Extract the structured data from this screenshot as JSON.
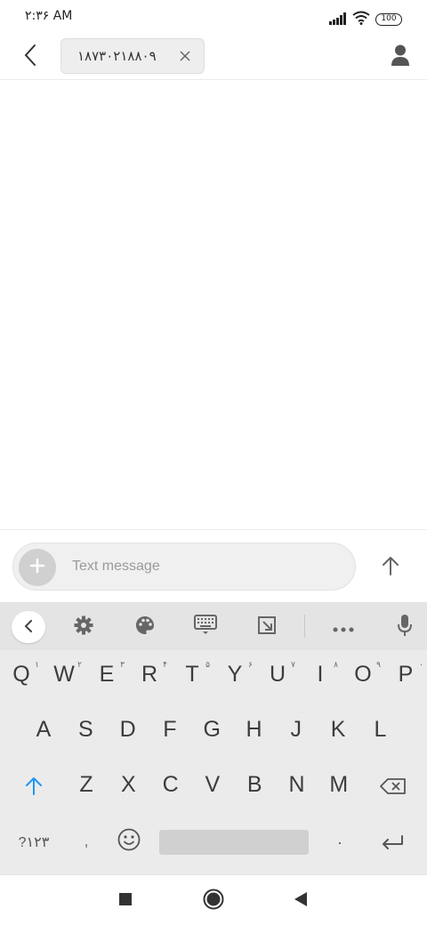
{
  "status_bar": {
    "time": "۲:۳۶ AM",
    "battery": "100"
  },
  "header": {
    "recipient": "۱۸۷۳۰۲۱۸۸۰۹"
  },
  "compose": {
    "placeholder": "Text message"
  },
  "keyboard": {
    "toolbar": [
      "collapse-icon",
      "gear-icon",
      "palette-icon",
      "keyboard-icon",
      "resize-icon",
      "more-icon",
      "mic-icon"
    ],
    "row1": [
      {
        "label": "Q",
        "hint": "۱"
      },
      {
        "label": "W",
        "hint": "۲"
      },
      {
        "label": "E",
        "hint": "۳"
      },
      {
        "label": "R",
        "hint": "۴"
      },
      {
        "label": "T",
        "hint": "۵"
      },
      {
        "label": "Y",
        "hint": "۶"
      },
      {
        "label": "U",
        "hint": "۷"
      },
      {
        "label": "I",
        "hint": "۸"
      },
      {
        "label": "O",
        "hint": "۹"
      },
      {
        "label": "P",
        "hint": "۰"
      }
    ],
    "row2": [
      "A",
      "S",
      "D",
      "F",
      "G",
      "H",
      "J",
      "K",
      "L"
    ],
    "row3": [
      "Z",
      "X",
      "C",
      "V",
      "B",
      "N",
      "M"
    ],
    "row4": {
      "symbols_label": "?۱۲۳",
      "comma_label": ",",
      "period_label": "·"
    }
  },
  "colors": {
    "accent": "#2196f3",
    "keyboard_bg": "#ebebeb",
    "toolbar_bg": "#e4e4e4",
    "key_text": "#3c3c3c"
  }
}
